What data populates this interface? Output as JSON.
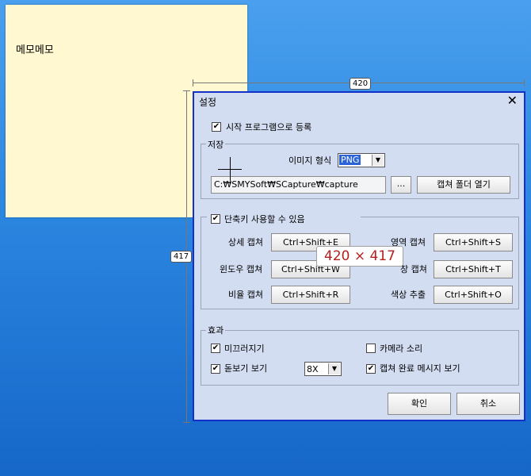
{
  "note": {
    "text": "메모메모"
  },
  "measure": {
    "width_label": "420",
    "height_label": "417",
    "size_overlay": "420 × 417"
  },
  "dialog": {
    "title": "설정",
    "close": "✕",
    "startup": {
      "label": "시작 프로그램으로 등록",
      "checked": true
    },
    "save": {
      "group_label": "저장",
      "image_format_label": "이미지 형식",
      "image_format_value": "PNG",
      "path_value": "C:₩SMYSoft₩SCapture₩capture",
      "browse_label": "...",
      "open_folder_label": "캡쳐 폴더 열기"
    },
    "hotkeys": {
      "enable_label": "단축키 사용할 수 있음",
      "enabled": true,
      "rows": [
        {
          "left_label": "상세 캡쳐",
          "left_key": "Ctrl+Shift+E",
          "right_label": "영역 캡쳐",
          "right_key": "Ctrl+Shift+S"
        },
        {
          "left_label": "윈도우 캡쳐",
          "left_key": "Ctrl+Shift+W",
          "right_label": "창 캡쳐",
          "right_key": "Ctrl+Shift+T"
        },
        {
          "left_label": "비율 캡쳐",
          "left_key": "Ctrl+Shift+R",
          "right_label": "색상 추출",
          "right_key": "Ctrl+Shift+O"
        }
      ]
    },
    "effects": {
      "group_label": "효과",
      "slide": {
        "label": "미끄러지기",
        "checked": true
      },
      "camera_sound": {
        "label": "카메라 소리",
        "checked": false
      },
      "magnifier": {
        "label": "돋보기 보기",
        "checked": true
      },
      "magnifier_zoom": "8X",
      "complete_message": {
        "label": "캡쳐 완료 메시지 보기",
        "checked": true
      }
    },
    "ok_label": "확인",
    "cancel_label": "취소"
  }
}
